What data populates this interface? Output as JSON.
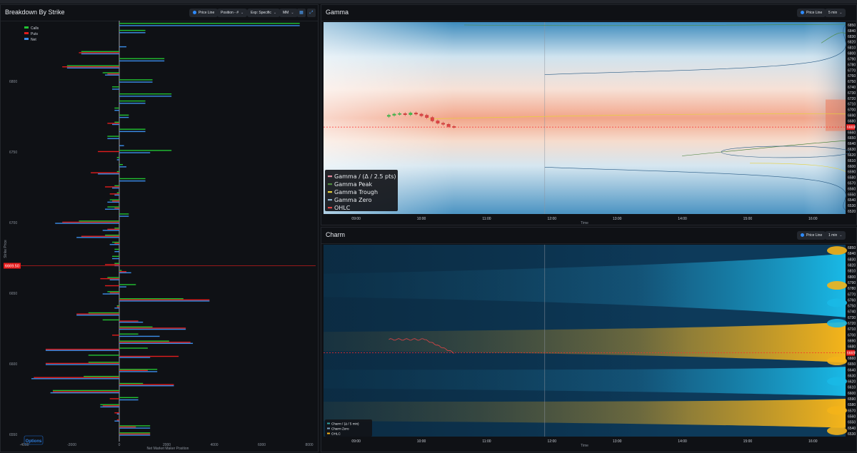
{
  "left_panel": {
    "title": "Breakdown By Strike",
    "controls": {
      "price_line": "Price Line",
      "position": "Position - #",
      "expiry": "Exp: Specific",
      "mm": "MM"
    },
    "legend": [
      "Calls",
      "Puts",
      "Net"
    ],
    "y_axis_label": "Strike Price",
    "x_axis_label": "Net Market Maker Position",
    "price_tag": "6669.50",
    "logo_text": "Options"
  },
  "gamma_panel": {
    "title": "Gamma",
    "controls": {
      "price_line": "Price Line",
      "interval": "5 min"
    },
    "x_axis_label": "Time",
    "price_tag": "6669",
    "legend": [
      "Gamma / (Δ / 2.5 pts)",
      "Gamma Peak",
      "Gamma Trough",
      "Gamma Zero",
      "OHLC"
    ]
  },
  "charm_panel": {
    "title": "Charm",
    "controls": {
      "price_line": "Price Line",
      "interval": "1 min"
    },
    "x_axis_label": "Time",
    "price_tag": "6669",
    "legend": [
      "Charm / (Δ / 5 min)",
      "Charm Zero",
      "OHLC"
    ]
  },
  "colors": {
    "calls": "#22c232",
    "puts": "#e11d1d",
    "net": "#3b8eea",
    "price_line": "#ff2a2a",
    "gamma_high": "#f2a58a",
    "gamma_low": "#3c8cc0",
    "charm_pos": "#f4b41a",
    "charm_neg": "#19b9e6"
  },
  "chart_data": [
    {
      "type": "bar",
      "orientation": "horizontal",
      "title": "Breakdown By Strike",
      "xlabel": "Net Market Maker Position",
      "ylabel": "Strike Price",
      "xlim": [
        -4000,
        8000
      ],
      "x_ticks": [
        "-4000",
        "-2000",
        "0",
        "2000",
        "4000",
        "6000",
        "8000"
      ],
      "ylim": [
        6545,
        6840
      ],
      "y_ticks": [
        "6800",
        "6750",
        "6700",
        "6650",
        "6600",
        "6550"
      ],
      "price_line": 6669.5,
      "strikes": [
        6840,
        6835,
        6830,
        6825,
        6820,
        6815,
        6810,
        6805,
        6800,
        6795,
        6790,
        6785,
        6780,
        6775,
        6770,
        6765,
        6760,
        6755,
        6750,
        6745,
        6740,
        6735,
        6730,
        6725,
        6720,
        6715,
        6710,
        6705,
        6700,
        6695,
        6690,
        6685,
        6680,
        6675,
        6670,
        6665,
        6660,
        6655,
        6650,
        6645,
        6640,
        6635,
        6630,
        6625,
        6620,
        6615,
        6610,
        6605,
        6600,
        6595,
        6590,
        6585,
        6580,
        6575,
        6570,
        6565,
        6560,
        6555,
        6550
      ],
      "series": [
        {
          "name": "Calls",
          "values": [
            7600,
            1100,
            0,
            0,
            -1600,
            1900,
            -2200,
            -700,
            1400,
            -300,
            2200,
            1100,
            -200,
            400,
            -200,
            1100,
            -500,
            0,
            2200,
            -100,
            150,
            -100,
            1100,
            -200,
            -100,
            -400,
            -500,
            400,
            -1700,
            -200,
            -600,
            -300,
            -200,
            -300,
            -200,
            100,
            -500,
            700,
            -500,
            2700,
            -100,
            -1300,
            -700,
            1400,
            800,
            2100,
            1200,
            -1300,
            -1300,
            1600,
            -1500,
            1000,
            -2800,
            800,
            -800,
            0,
            0,
            1300,
            1300
          ]
        },
        {
          "name": "Puts",
          "values": [
            0,
            0,
            0,
            0,
            -1700,
            0,
            -2400,
            -500,
            0,
            0,
            0,
            0,
            0,
            0,
            -500,
            0,
            0,
            0,
            -900,
            0,
            0,
            -1200,
            0,
            -600,
            -400,
            -300,
            -200,
            0,
            -2400,
            -500,
            -1600,
            -200,
            0,
            0,
            -600,
            300,
            -800,
            -600,
            -400,
            3800,
            -100,
            -1800,
            800,
            2800,
            -300,
            3000,
            -3100,
            2500,
            -3100,
            1200,
            -3600,
            2300,
            -2800,
            -400,
            -700,
            -200,
            -100,
            700,
            1300
          ]
        },
        {
          "name": "Net",
          "values": [
            7600,
            1100,
            0,
            300,
            -1600,
            1900,
            -2200,
            -600,
            1400,
            -300,
            2200,
            1100,
            -200,
            400,
            -300,
            1100,
            -500,
            200,
            1300,
            -100,
            300,
            -900,
            1100,
            -300,
            -200,
            -500,
            -600,
            400,
            -2700,
            -700,
            -1800,
            -400,
            -200,
            -300,
            -200,
            500,
            -400,
            300,
            -700,
            3800,
            -200,
            -1800,
            1000,
            2800,
            1700,
            3100,
            -3100,
            1300,
            -3100,
            1600,
            -3700,
            2300,
            -2900,
            800,
            -800,
            -100,
            -200,
            1300,
            1300
          ]
        }
      ]
    },
    {
      "type": "heatmap",
      "title": "Gamma",
      "xlabel": "Time",
      "x_ticks": [
        "09:00",
        "10:00",
        "11:00",
        "12:00",
        "13:00",
        "14:00",
        "15:00",
        "16:00"
      ],
      "y_ticks": [
        "6850",
        "6840",
        "6830",
        "6820",
        "6810",
        "6800",
        "6790",
        "6780",
        "6770",
        "6760",
        "6750",
        "6740",
        "6730",
        "6720",
        "6710",
        "6700",
        "6690",
        "6680",
        "6670",
        "6660",
        "6650",
        "6640",
        "6630",
        "6620",
        "6610",
        "6600",
        "6590",
        "6580",
        "6570",
        "6560",
        "6550",
        "6540",
        "6530",
        "6520"
      ],
      "ylim": [
        6515,
        6855
      ],
      "price_line": 6669,
      "series": [
        {
          "name": "Gamma / (Δ / 2.5 pts)",
          "description": "heat field, peak near 6690"
        },
        {
          "name": "Gamma Peak",
          "x": [
            "10:30",
            "16:00"
          ],
          "y": [
            6760,
            6765
          ]
        },
        {
          "name": "Gamma Trough",
          "x": [
            "10:00",
            "16:00"
          ],
          "y": [
            6690,
            6692
          ]
        },
        {
          "name": "Gamma Zero",
          "x": [
            "10:30",
            "16:00"
          ],
          "y": [
            6600,
            6595
          ]
        },
        {
          "name": "OHLC",
          "x": [
            "09:30",
            "09:35",
            "09:40",
            "09:45",
            "09:50",
            "09:55",
            "10:00",
            "10:05",
            "10:10",
            "10:15",
            "10:20",
            "10:25",
            "10:30"
          ],
          "open": [
            6688,
            6690,
            6692,
            6693,
            6691,
            6694,
            6692,
            6690,
            6686,
            6680,
            6676,
            6674,
            6670
          ],
          "close": [
            6690,
            6692,
            6693,
            6691,
            6694,
            6692,
            6689,
            6686,
            6680,
            6676,
            6674,
            6670,
            6669
          ]
        }
      ]
    },
    {
      "type": "heatmap",
      "title": "Charm",
      "xlabel": "Time",
      "x_ticks": [
        "09:00",
        "10:00",
        "11:00",
        "12:00",
        "13:00",
        "14:00",
        "15:00",
        "16:00"
      ],
      "y_ticks": [
        "6850",
        "6840",
        "6830",
        "6820",
        "6810",
        "6800",
        "6790",
        "6780",
        "6770",
        "6760",
        "6750",
        "6740",
        "6730",
        "6720",
        "6710",
        "6700",
        "6690",
        "6680",
        "6670",
        "6660",
        "6650",
        "6640",
        "6630",
        "6620",
        "6610",
        "6600",
        "6590",
        "6580",
        "6570",
        "6560",
        "6550",
        "6540",
        "6530"
      ],
      "ylim": [
        6525,
        6855
      ],
      "price_line": 6669,
      "series": [
        {
          "name": "Charm / (Δ / 5 min)",
          "description": "positive bands near 6690 and 6560, negative bands near 6790 and 6620"
        },
        {
          "name": "Charm Zero"
        },
        {
          "name": "OHLC",
          "x": [
            "09:30",
            "10:30"
          ],
          "y": [
            6692,
            6669
          ]
        }
      ]
    }
  ]
}
